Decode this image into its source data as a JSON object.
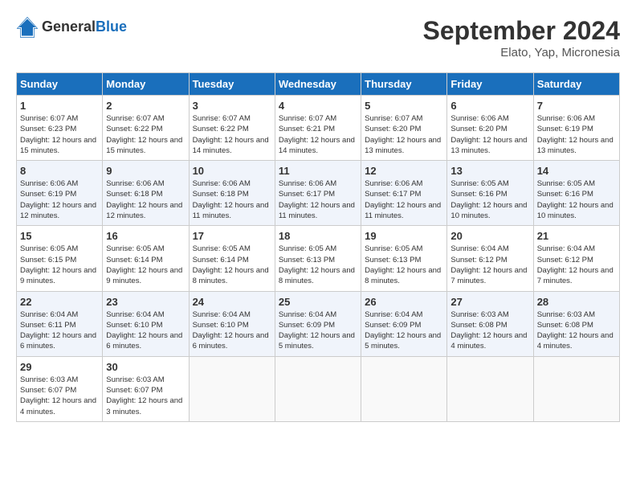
{
  "header": {
    "logo_general": "General",
    "logo_blue": "Blue",
    "month_title": "September 2024",
    "location": "Elato, Yap, Micronesia"
  },
  "columns": [
    "Sunday",
    "Monday",
    "Tuesday",
    "Wednesday",
    "Thursday",
    "Friday",
    "Saturday"
  ],
  "weeks": [
    [
      {
        "num": "1",
        "sunrise": "6:07 AM",
        "sunset": "6:23 PM",
        "daylight": "12 hours and 15 minutes."
      },
      {
        "num": "2",
        "sunrise": "6:07 AM",
        "sunset": "6:22 PM",
        "daylight": "12 hours and 15 minutes."
      },
      {
        "num": "3",
        "sunrise": "6:07 AM",
        "sunset": "6:22 PM",
        "daylight": "12 hours and 14 minutes."
      },
      {
        "num": "4",
        "sunrise": "6:07 AM",
        "sunset": "6:21 PM",
        "daylight": "12 hours and 14 minutes."
      },
      {
        "num": "5",
        "sunrise": "6:07 AM",
        "sunset": "6:20 PM",
        "daylight": "12 hours and 13 minutes."
      },
      {
        "num": "6",
        "sunrise": "6:06 AM",
        "sunset": "6:20 PM",
        "daylight": "12 hours and 13 minutes."
      },
      {
        "num": "7",
        "sunrise": "6:06 AM",
        "sunset": "6:19 PM",
        "daylight": "12 hours and 13 minutes."
      }
    ],
    [
      {
        "num": "8",
        "sunrise": "6:06 AM",
        "sunset": "6:19 PM",
        "daylight": "12 hours and 12 minutes."
      },
      {
        "num": "9",
        "sunrise": "6:06 AM",
        "sunset": "6:18 PM",
        "daylight": "12 hours and 12 minutes."
      },
      {
        "num": "10",
        "sunrise": "6:06 AM",
        "sunset": "6:18 PM",
        "daylight": "12 hours and 11 minutes."
      },
      {
        "num": "11",
        "sunrise": "6:06 AM",
        "sunset": "6:17 PM",
        "daylight": "12 hours and 11 minutes."
      },
      {
        "num": "12",
        "sunrise": "6:06 AM",
        "sunset": "6:17 PM",
        "daylight": "12 hours and 11 minutes."
      },
      {
        "num": "13",
        "sunrise": "6:05 AM",
        "sunset": "6:16 PM",
        "daylight": "12 hours and 10 minutes."
      },
      {
        "num": "14",
        "sunrise": "6:05 AM",
        "sunset": "6:16 PM",
        "daylight": "12 hours and 10 minutes."
      }
    ],
    [
      {
        "num": "15",
        "sunrise": "6:05 AM",
        "sunset": "6:15 PM",
        "daylight": "12 hours and 9 minutes."
      },
      {
        "num": "16",
        "sunrise": "6:05 AM",
        "sunset": "6:14 PM",
        "daylight": "12 hours and 9 minutes."
      },
      {
        "num": "17",
        "sunrise": "6:05 AM",
        "sunset": "6:14 PM",
        "daylight": "12 hours and 8 minutes."
      },
      {
        "num": "18",
        "sunrise": "6:05 AM",
        "sunset": "6:13 PM",
        "daylight": "12 hours and 8 minutes."
      },
      {
        "num": "19",
        "sunrise": "6:05 AM",
        "sunset": "6:13 PM",
        "daylight": "12 hours and 8 minutes."
      },
      {
        "num": "20",
        "sunrise": "6:04 AM",
        "sunset": "6:12 PM",
        "daylight": "12 hours and 7 minutes."
      },
      {
        "num": "21",
        "sunrise": "6:04 AM",
        "sunset": "6:12 PM",
        "daylight": "12 hours and 7 minutes."
      }
    ],
    [
      {
        "num": "22",
        "sunrise": "6:04 AM",
        "sunset": "6:11 PM",
        "daylight": "12 hours and 6 minutes."
      },
      {
        "num": "23",
        "sunrise": "6:04 AM",
        "sunset": "6:10 PM",
        "daylight": "12 hours and 6 minutes."
      },
      {
        "num": "24",
        "sunrise": "6:04 AM",
        "sunset": "6:10 PM",
        "daylight": "12 hours and 6 minutes."
      },
      {
        "num": "25",
        "sunrise": "6:04 AM",
        "sunset": "6:09 PM",
        "daylight": "12 hours and 5 minutes."
      },
      {
        "num": "26",
        "sunrise": "6:04 AM",
        "sunset": "6:09 PM",
        "daylight": "12 hours and 5 minutes."
      },
      {
        "num": "27",
        "sunrise": "6:03 AM",
        "sunset": "6:08 PM",
        "daylight": "12 hours and 4 minutes."
      },
      {
        "num": "28",
        "sunrise": "6:03 AM",
        "sunset": "6:08 PM",
        "daylight": "12 hours and 4 minutes."
      }
    ],
    [
      {
        "num": "29",
        "sunrise": "6:03 AM",
        "sunset": "6:07 PM",
        "daylight": "12 hours and 4 minutes."
      },
      {
        "num": "30",
        "sunrise": "6:03 AM",
        "sunset": "6:07 PM",
        "daylight": "12 hours and 3 minutes."
      },
      null,
      null,
      null,
      null,
      null
    ]
  ]
}
